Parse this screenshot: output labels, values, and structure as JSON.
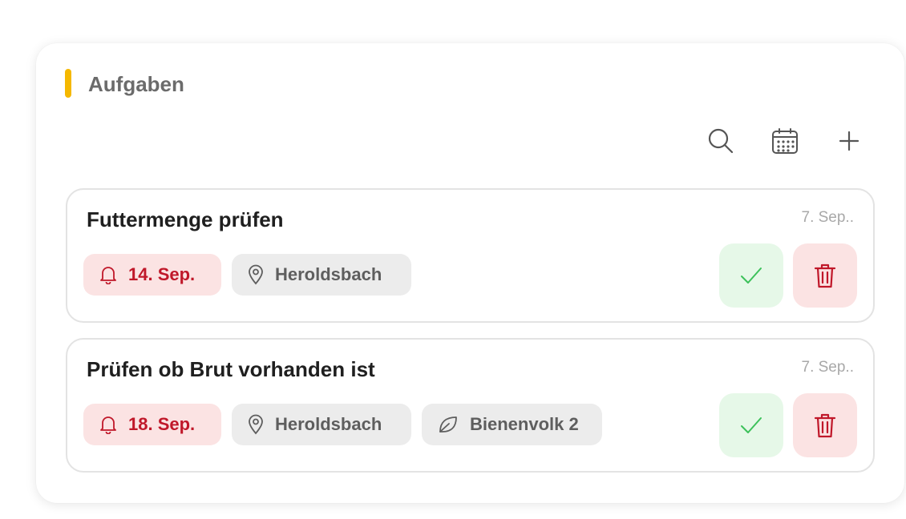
{
  "header": {
    "title": "Aufgaben",
    "accent_color": "#f5b800"
  },
  "toolbar": [
    {
      "name": "search-button",
      "icon": "search-icon"
    },
    {
      "name": "calendar-button",
      "icon": "calendar-icon"
    },
    {
      "name": "add-button",
      "icon": "plus-icon"
    }
  ],
  "tasks": [
    {
      "title": "Futtermenge prüfen",
      "created": "7. Sep..",
      "due": "14. Sep.",
      "location": "Heroldsbach",
      "colony": null
    },
    {
      "title": "Prüfen ob Brut vorhanden ist",
      "created": "7. Sep..",
      "due": "18. Sep.",
      "location": "Heroldsbach",
      "colony": "Bienenvolk 2"
    }
  ],
  "colors": {
    "due_text": "#c0182a",
    "due_bg": "#fbe3e3",
    "done_check": "#3cc15a",
    "done_bg": "#e6f8e8",
    "delete_icon": "#c0182a"
  }
}
